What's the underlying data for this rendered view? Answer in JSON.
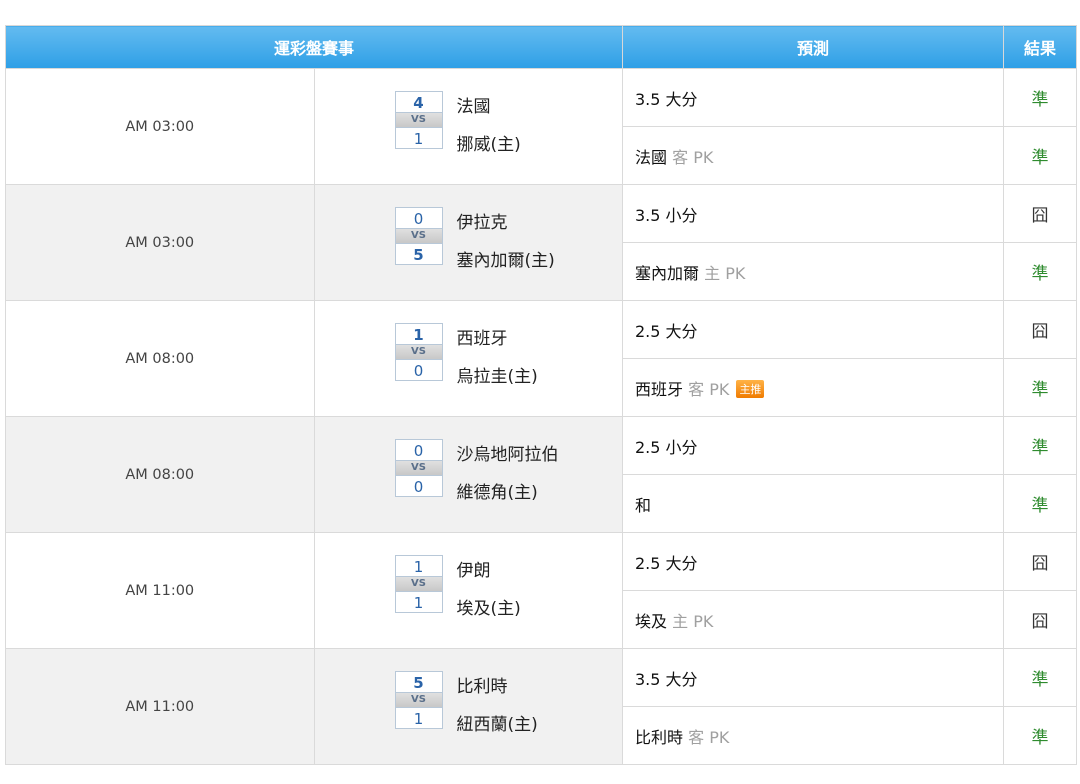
{
  "headers": {
    "match": "運彩盤賽事",
    "prediction": "預測",
    "result": "結果"
  },
  "games": [
    {
      "time": "AM 03:00",
      "home_score": "4",
      "away_score": "1",
      "vs": "VS",
      "team1": "法國",
      "team2": "挪威(主)",
      "pred1": {
        "main": "3.5 大分",
        "suffix": "",
        "badge": "",
        "result": "準"
      },
      "pred2": {
        "main": "法國",
        "suffix": "客 PK",
        "badge": "",
        "result": "準"
      }
    },
    {
      "time": "AM 03:00",
      "home_score": "0",
      "away_score": "5",
      "vs": "VS",
      "team1": "伊拉克",
      "team2": "塞內加爾(主)",
      "pred1": {
        "main": "3.5 小分",
        "suffix": "",
        "badge": "",
        "result": "囧"
      },
      "pred2": {
        "main": "塞內加爾",
        "suffix": "主 PK",
        "badge": "",
        "result": "準"
      }
    },
    {
      "time": "AM 08:00",
      "home_score": "1",
      "away_score": "0",
      "vs": "VS",
      "team1": "西班牙",
      "team2": "烏拉圭(主)",
      "pred1": {
        "main": "2.5 大分",
        "suffix": "",
        "badge": "",
        "result": "囧"
      },
      "pred2": {
        "main": "西班牙",
        "suffix": "客 PK",
        "badge": "主推",
        "result": "準"
      }
    },
    {
      "time": "AM 08:00",
      "home_score": "0",
      "away_score": "0",
      "vs": "VS",
      "team1": "沙烏地阿拉伯",
      "team2": "維德角(主)",
      "pred1": {
        "main": "2.5 小分",
        "suffix": "",
        "badge": "",
        "result": "準"
      },
      "pred2": {
        "main": "和",
        "suffix": "",
        "badge": "",
        "result": "準"
      }
    },
    {
      "time": "AM 11:00",
      "home_score": "1",
      "away_score": "1",
      "vs": "VS",
      "team1": "伊朗",
      "team2": "埃及(主)",
      "pred1": {
        "main": "2.5 大分",
        "suffix": "",
        "badge": "",
        "result": "囧"
      },
      "pred2": {
        "main": "埃及",
        "suffix": "主 PK",
        "badge": "",
        "result": "囧"
      }
    },
    {
      "time": "AM 11:00",
      "home_score": "5",
      "away_score": "1",
      "vs": "VS",
      "team1": "比利時",
      "team2": "紐西蘭(主)",
      "pred1": {
        "main": "3.5 大分",
        "suffix": "",
        "badge": "",
        "result": "準"
      },
      "pred2": {
        "main": "比利時",
        "suffix": "客 PK",
        "badge": "",
        "result": "準"
      }
    }
  ]
}
